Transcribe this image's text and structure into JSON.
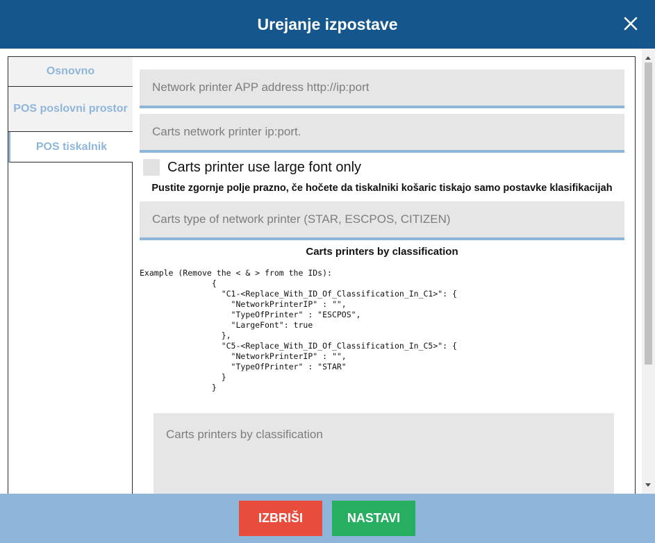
{
  "dialog": {
    "title": "Urejanje izpostave"
  },
  "tabs": [
    {
      "label": "Osnovno"
    },
    {
      "label": "POS poslovni prostor"
    },
    {
      "label": "POS tiskalnik"
    }
  ],
  "form": {
    "network_printer_app_address": {
      "value": "",
      "placeholder": "Network printer APP address http://ip:port"
    },
    "carts_network_printer": {
      "value": "",
      "placeholder": "Carts network printer ip:port."
    },
    "large_font_checkbox": {
      "label": "Carts printer use large font only",
      "checked": false
    },
    "hint": "Pustite zgornje polje prazno, če hočete da tiskalniki košaric tiskajo samo postavke klasifikacijah",
    "carts_printer_type": {
      "value": "",
      "placeholder": "Carts type of network printer (STAR, ESCPOS, CITIZEN)"
    },
    "classification_section_title": "Carts printers by classification",
    "example_text": "Example (Remove the < & > from the IDs):\n               {\n                 \"C1-<Replace_With_ID_Of_Classification_In_C1>\": {\n                   \"NetworkPrinterIP\" : \"\",\n                   \"TypeOfPrinter\" : \"ESCPOS\",\n                   \"LargeFont\": true\n                 },\n                 \"C5-<Replace_With_ID_Of_Classification_In_C5>\": {\n                   \"NetworkPrinterIP\" : \"\",\n                   \"TypeOfPrinter\" : \"STAR\"\n                 }\n               }",
    "classification_textarea": {
      "value": "",
      "placeholder": "Carts printers by classification"
    }
  },
  "footer": {
    "delete_label": "IZBRIŠI",
    "continue_label": "NASTAVI"
  },
  "colors": {
    "header_bg": "#15578c",
    "footer_bg": "#8eb6da",
    "accent": "#8eb6da",
    "delete_button": "#e84c3d",
    "continue_button": "#27ae60"
  },
  "icons": {
    "close": "close-icon"
  }
}
